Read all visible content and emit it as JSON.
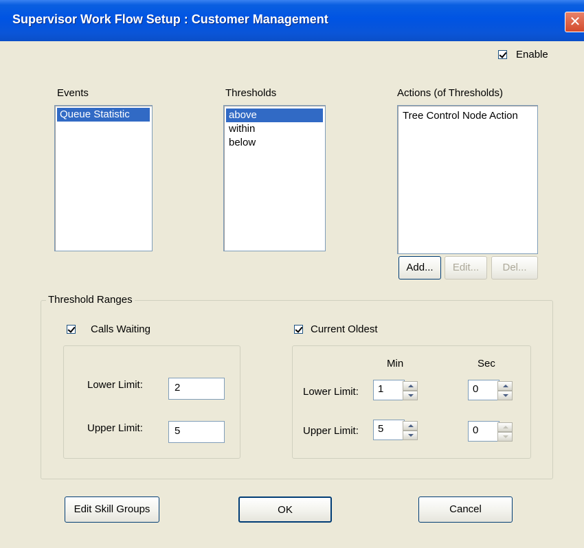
{
  "window": {
    "title": "Supervisor Work Flow Setup :  Customer Management",
    "close_glyph": "✕"
  },
  "enable": {
    "label": "Enable",
    "checked": true
  },
  "events": {
    "heading": "Events",
    "items": [
      {
        "label": "Queue Statistic",
        "selected": true
      }
    ]
  },
  "thresholds": {
    "heading": "Thresholds",
    "items": [
      {
        "label": "above",
        "selected": true
      },
      {
        "label": "within",
        "selected": false
      },
      {
        "label": "below",
        "selected": false
      }
    ]
  },
  "actions": {
    "heading": "Actions (of Thresholds)",
    "items": [
      {
        "label": "Tree Control Node Action",
        "selected": false
      }
    ],
    "add_label": "Add...",
    "edit_label": "Edit...",
    "del_label": "Del..."
  },
  "threshold_ranges": {
    "title": "Threshold Ranges",
    "calls_waiting": {
      "label": "Calls Waiting",
      "checked": true,
      "lower_label": "Lower Limit:",
      "lower_value": "2",
      "upper_label": "Upper Limit:",
      "upper_value": "5"
    },
    "current_oldest": {
      "label": "Current Oldest",
      "checked": true,
      "min_header": "Min",
      "sec_header": "Sec",
      "lower_label": "Lower Limit:",
      "lower_min": "1",
      "lower_sec": "0",
      "upper_label": "Upper Limit:",
      "upper_min": "5",
      "upper_sec": "0"
    }
  },
  "footer": {
    "edit_skill_groups": "Edit Skill Groups",
    "ok": "OK",
    "cancel": "Cancel"
  },
  "colors": {
    "titlebar": "#0054e3",
    "selection": "#316ac5",
    "dialog_bg": "#ece9d8"
  }
}
